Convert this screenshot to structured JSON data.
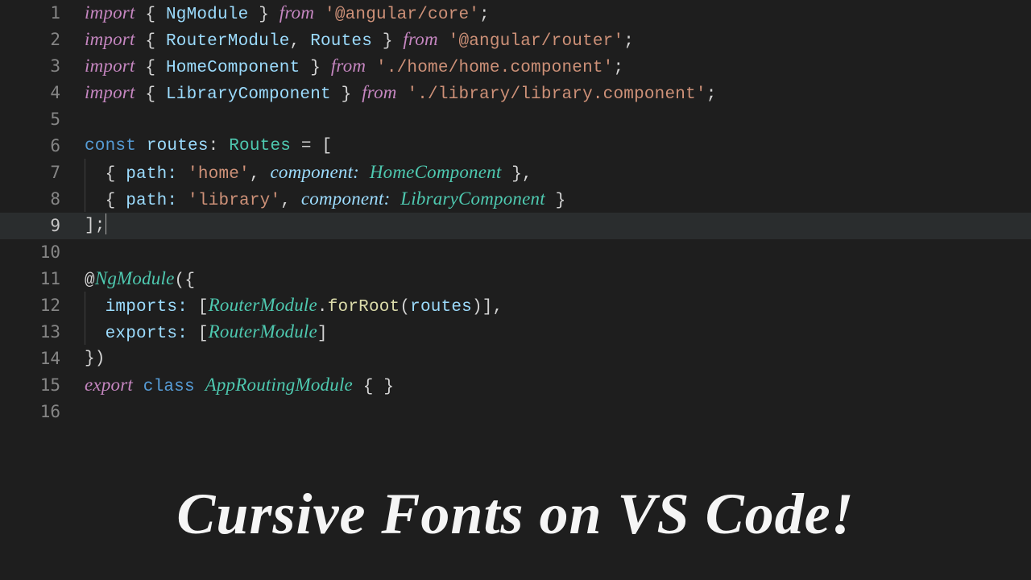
{
  "banner": "Cursive Fonts on VS Code!",
  "lines": [
    {
      "n": "1",
      "tokens": [
        {
          "c": "kw",
          "t": "import"
        },
        {
          "t": " "
        },
        {
          "c": "pu",
          "t": "{ "
        },
        {
          "c": "id",
          "t": "NgModule"
        },
        {
          "c": "pu",
          "t": " } "
        },
        {
          "c": "kw",
          "t": "from"
        },
        {
          "t": " "
        },
        {
          "c": "st",
          "t": "'@angular/core'"
        },
        {
          "c": "pu",
          "t": ";"
        }
      ]
    },
    {
      "n": "2",
      "tokens": [
        {
          "c": "kw",
          "t": "import"
        },
        {
          "t": " "
        },
        {
          "c": "pu",
          "t": "{ "
        },
        {
          "c": "id",
          "t": "RouterModule"
        },
        {
          "c": "pu",
          "t": ", "
        },
        {
          "c": "id",
          "t": "Routes"
        },
        {
          "c": "pu",
          "t": " } "
        },
        {
          "c": "kw",
          "t": "from"
        },
        {
          "t": " "
        },
        {
          "c": "st",
          "t": "'@angular/router'"
        },
        {
          "c": "pu",
          "t": ";"
        }
      ]
    },
    {
      "n": "3",
      "tokens": [
        {
          "c": "kw",
          "t": "import"
        },
        {
          "t": " "
        },
        {
          "c": "pu",
          "t": "{ "
        },
        {
          "c": "id",
          "t": "HomeComponent"
        },
        {
          "c": "pu",
          "t": " } "
        },
        {
          "c": "kw",
          "t": "from"
        },
        {
          "t": " "
        },
        {
          "c": "st",
          "t": "'./home/home.component'"
        },
        {
          "c": "pu",
          "t": ";"
        }
      ]
    },
    {
      "n": "4",
      "tokens": [
        {
          "c": "kw",
          "t": "import"
        },
        {
          "t": " "
        },
        {
          "c": "pu",
          "t": "{ "
        },
        {
          "c": "id",
          "t": "LibraryComponent"
        },
        {
          "c": "pu",
          "t": " } "
        },
        {
          "c": "kw",
          "t": "from"
        },
        {
          "t": " "
        },
        {
          "c": "st",
          "t": "'./library/library.component'"
        },
        {
          "c": "pu",
          "t": ";"
        }
      ]
    },
    {
      "n": "5",
      "tokens": []
    },
    {
      "n": "6",
      "tokens": [
        {
          "c": "bl",
          "t": "const"
        },
        {
          "t": " "
        },
        {
          "c": "id",
          "t": "routes"
        },
        {
          "c": "pu",
          "t": ": "
        },
        {
          "c": "ty",
          "t": "Routes"
        },
        {
          "t": " "
        },
        {
          "c": "pu",
          "t": "= ["
        }
      ]
    },
    {
      "n": "7",
      "tokens": [
        {
          "guide": true
        },
        {
          "t": "  "
        },
        {
          "c": "pu",
          "t": "{ "
        },
        {
          "c": "id",
          "t": "path:"
        },
        {
          "t": " "
        },
        {
          "c": "st",
          "t": "'home'"
        },
        {
          "c": "pu",
          "t": ", "
        },
        {
          "c": "pr",
          "t": "component:"
        },
        {
          "t": " "
        },
        {
          "c": "tyc",
          "t": "HomeComponent"
        },
        {
          "t": " "
        },
        {
          "c": "pu",
          "t": "},"
        }
      ]
    },
    {
      "n": "8",
      "tokens": [
        {
          "guide": true
        },
        {
          "t": "  "
        },
        {
          "c": "pu",
          "t": "{ "
        },
        {
          "c": "id",
          "t": "path:"
        },
        {
          "t": " "
        },
        {
          "c": "st",
          "t": "'library'"
        },
        {
          "c": "pu",
          "t": ", "
        },
        {
          "c": "pr",
          "t": "component:"
        },
        {
          "t": " "
        },
        {
          "c": "tyc",
          "t": "LibraryComponent"
        },
        {
          "t": " "
        },
        {
          "c": "pu",
          "t": "}"
        }
      ]
    },
    {
      "n": "9",
      "hl": true,
      "tokens": [
        {
          "c": "pu",
          "t": "];"
        },
        {
          "caret": true
        }
      ]
    },
    {
      "n": "10",
      "tokens": []
    },
    {
      "n": "11",
      "tokens": [
        {
          "c": "pu",
          "t": "@"
        },
        {
          "c": "tyc",
          "t": "NgModule"
        },
        {
          "c": "pu",
          "t": "({"
        }
      ]
    },
    {
      "n": "12",
      "tokens": [
        {
          "guide": true
        },
        {
          "t": "  "
        },
        {
          "c": "id",
          "t": "imports:"
        },
        {
          "t": " "
        },
        {
          "c": "pu",
          "t": "["
        },
        {
          "c": "tyc",
          "t": "RouterModule"
        },
        {
          "c": "pu",
          "t": "."
        },
        {
          "c": "fn",
          "t": "forRoot"
        },
        {
          "c": "pu",
          "t": "("
        },
        {
          "c": "id",
          "t": "routes"
        },
        {
          "c": "pu",
          "t": ")],"
        }
      ]
    },
    {
      "n": "13",
      "tokens": [
        {
          "guide": true
        },
        {
          "t": "  "
        },
        {
          "c": "id",
          "t": "exports:"
        },
        {
          "t": " "
        },
        {
          "c": "pu",
          "t": "["
        },
        {
          "c": "tyc",
          "t": "RouterModule"
        },
        {
          "c": "pu",
          "t": "]"
        }
      ]
    },
    {
      "n": "14",
      "tokens": [
        {
          "c": "pu",
          "t": "})"
        }
      ]
    },
    {
      "n": "15",
      "tokens": [
        {
          "c": "kw",
          "t": "export"
        },
        {
          "t": " "
        },
        {
          "c": "bl",
          "t": "class"
        },
        {
          "t": " "
        },
        {
          "c": "tyc",
          "t": "AppRoutingModule"
        },
        {
          "t": " "
        },
        {
          "c": "pu",
          "t": "{ }"
        }
      ]
    },
    {
      "n": "16",
      "tokens": []
    }
  ]
}
